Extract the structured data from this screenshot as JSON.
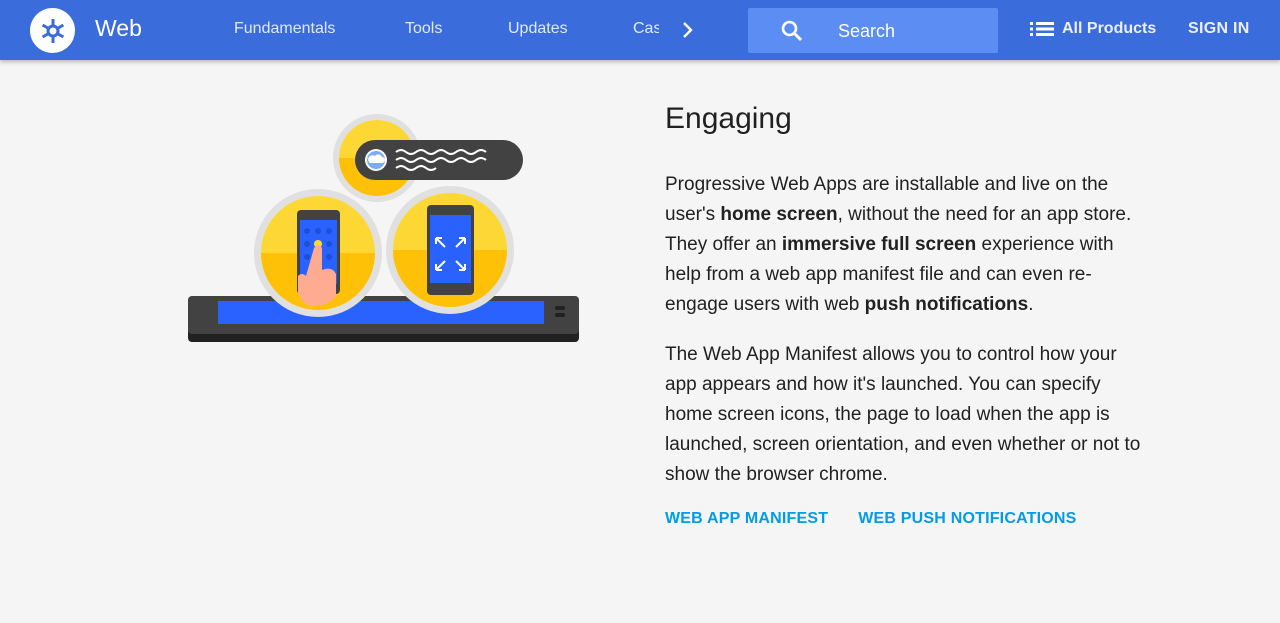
{
  "header": {
    "site_name": "Web",
    "nav": [
      "Fundamentals",
      "Tools",
      "Updates",
      "Cas"
    ],
    "search_placeholder": "Search",
    "all_products": "All Products",
    "sign_in": "SIGN IN"
  },
  "main": {
    "heading": "Engaging",
    "p1": {
      "t1": "Progressive Web Apps are installable and live on the user's ",
      "b1": "home screen",
      "t2": ", without the need for an app store. They offer an ",
      "b2": "immersive full screen",
      "t3": " experience with help from a web app manifest file and can even re-engage users with web ",
      "b3": "push notifications",
      "t4": "."
    },
    "p2": "The Web App Manifest allows you to control how your app appears and how it's launched. You can specify home screen icons, the page to load when the app is launched, screen orientation, and even whether or not to show the browser chrome.",
    "links": [
      "WEB APP MANIFEST",
      "WEB PUSH NOTIFICATIONS"
    ]
  },
  "colors": {
    "header_bg": "#3b6cdc",
    "search_bg": "#5b8df2",
    "link": "#039be5",
    "illustration_yellow": "#fdd835",
    "illustration_blue": "#2962ff"
  }
}
